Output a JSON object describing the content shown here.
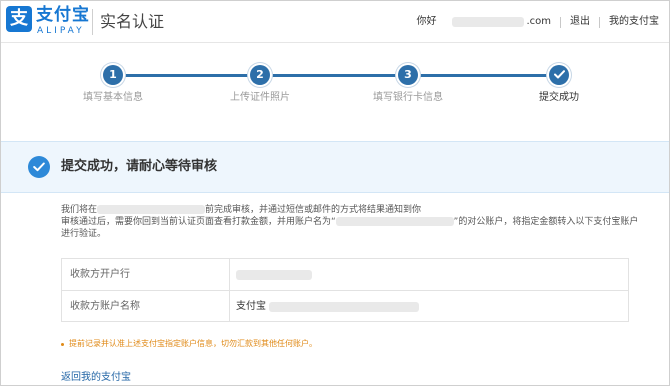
{
  "header": {
    "logo_mark": "支",
    "logo_name": "支付宝",
    "logo_sub": "ALIPAY",
    "page_title": "实名认证",
    "greeting": "你好",
    "account_suffix": ".com",
    "logout": "退出",
    "my_alipay": "我的支付宝"
  },
  "steps": [
    {
      "number": "1",
      "label": "填写基本信息",
      "state": "done"
    },
    {
      "number": "2",
      "label": "上传证件照片",
      "state": "done"
    },
    {
      "number": "3",
      "label": "填写银行卡信息",
      "state": "done"
    },
    {
      "number": "",
      "label": "提交成功",
      "state": "current",
      "icon": "check-icon"
    }
  ],
  "banner": {
    "icon": "check-circle-icon",
    "title": "提交成功，请耐心等待审核"
  },
  "notice": {
    "p1_before": "我们将在",
    "p1_after": "前完成审核，并通过短信或邮件的方式将结果通知到你",
    "p2_before": "审核通过后，需要你回到当前认证页面查看打款金额，并用账户名为“",
    "p2_after": "”的对公账户，将指定金额转入以下支付宝账户进行验证。"
  },
  "info_table": {
    "rows": [
      {
        "label": "收款方开户行",
        "value": ""
      },
      {
        "label": "收款方账户名称",
        "value": "支付宝"
      }
    ]
  },
  "warning": "提前记录并认准上述支付宝指定账户信息，切勿汇款到其他任何账户。",
  "back_link": "返回我的支付宝",
  "colors": {
    "brand": "#1677d2",
    "step_active": "#2d6fa9",
    "banner_bg": "#eef6fd",
    "warning": "#e08a17",
    "link": "#2366a6"
  }
}
